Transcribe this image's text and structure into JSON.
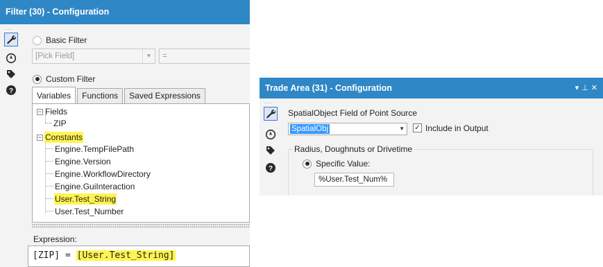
{
  "filter_panel": {
    "title": "Filter (30) - Configuration",
    "sidebar": {
      "handle": "...",
      "icons": [
        "wrench-icon",
        "compass-icon",
        "tag-icon",
        "help-icon"
      ]
    },
    "basic_filter": {
      "label": "Basic Filter",
      "selected": false,
      "field_value": "[Pick Field]",
      "operator_value": "="
    },
    "custom_filter": {
      "label": "Custom Filter",
      "selected": true
    },
    "tabs": [
      {
        "label": "Variables",
        "active": true
      },
      {
        "label": "Functions",
        "active": false
      },
      {
        "label": "Saved Expressions",
        "active": false
      }
    ],
    "tree": {
      "fields": {
        "label": "Fields",
        "expander": "−",
        "children": [
          "ZIP"
        ]
      },
      "constants": {
        "label": "Constants",
        "expander": "−",
        "children": [
          "Engine.TempFilePath",
          "Engine.Version",
          "Engine.WorkflowDirectory",
          "Engine.GuiInteraction",
          "User.Test_String",
          "User.Test_Number"
        ],
        "highlighted_child": "User.Test_String"
      }
    },
    "expression": {
      "label": "Expression:",
      "prefix": "[ZIP] = ",
      "highlighted": "[User.Test_String]"
    },
    "highlight_color": "#fff44f"
  },
  "trade_panel": {
    "title": "Trade Area (31) - Configuration",
    "title_controls": {
      "dropdown": "▾",
      "pin": "⊥",
      "close": "✕"
    },
    "sidebar": {
      "handle": "...",
      "icons": [
        "wrench-icon",
        "compass-icon",
        "tag-icon",
        "help-icon"
      ]
    },
    "spatial_field_label": "SpatialObject Field of Point Source",
    "spatial_field_value": "SpatialObj",
    "include_output": {
      "label": "Include in Output",
      "checked": true,
      "mark": "✓"
    },
    "radius_group_label": "Radius, Doughnuts or Drivetime",
    "specific_value": {
      "label": "Specific Value:",
      "selected": true
    },
    "specific_value_input": "%User.Test_Num%"
  },
  "colors": {
    "title_bar": "#2f87c6",
    "panel_bg": "#f3f3f3",
    "selection_blue": "#3399ff"
  }
}
